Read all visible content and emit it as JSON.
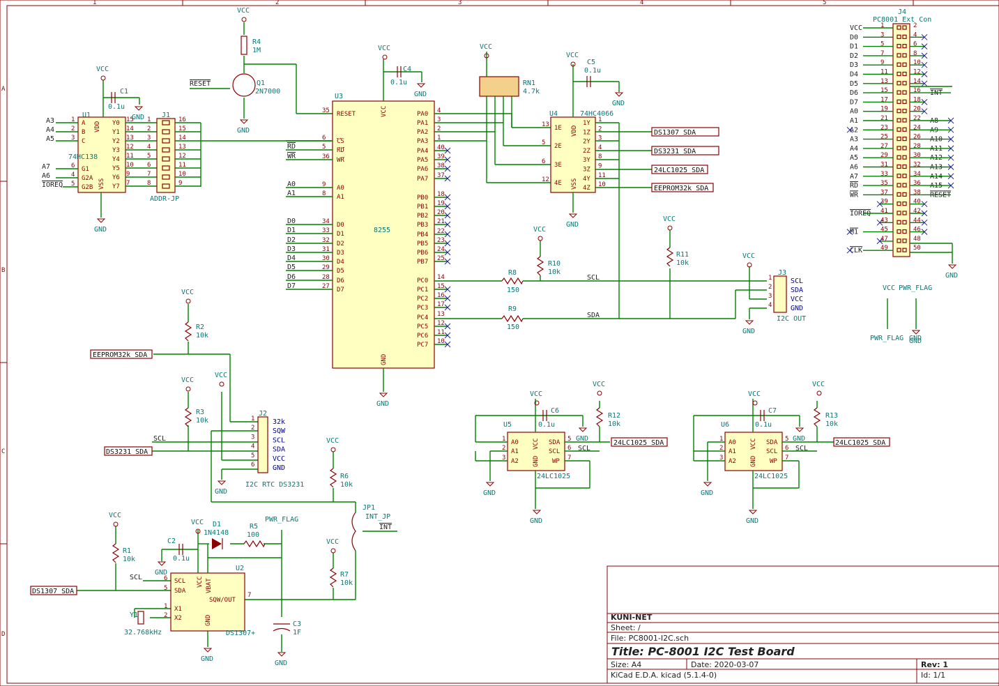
{
  "frame": {
    "col_numbers": [
      "1",
      "2",
      "3",
      "4",
      "5"
    ],
    "row_letters": [
      "A",
      "B",
      "C",
      "D"
    ]
  },
  "title_block": {
    "company": "KUNI-NET",
    "sheet": "Sheet: /",
    "file": "File: PC8001-I2C.sch",
    "title": "Title: PC-8001 I2C Test Board",
    "size": "Size: A4",
    "date": "Date: 2020-03-07",
    "rev": "Rev: 1",
    "tool": "KiCad E.D.A.  kicad (5.1.4-0)",
    "id": "Id: 1/1"
  },
  "power": {
    "vcc": "VCC",
    "gnd": "GND",
    "pwr_flag": "PWR_FLAG"
  },
  "u1": {
    "ref": "U1",
    "value": "74HC138",
    "pins_left": [
      "A",
      "B",
      "C",
      "G1",
      "G2A",
      "G2B"
    ],
    "pins_right": [
      "Y0",
      "Y1",
      "Y2",
      "Y3",
      "Y4",
      "Y5",
      "Y6",
      "Y7"
    ],
    "vdd": "VDD",
    "vss": "VSS",
    "inputs": [
      "A3",
      "A4",
      "A5",
      "A7",
      "A6",
      "IOREQ"
    ]
  },
  "c1": {
    "ref": "C1",
    "value": "0.1u"
  },
  "j1": {
    "ref": "J1",
    "value": "ADDR-JP"
  },
  "r4": {
    "ref": "R4",
    "value": "1M"
  },
  "q1": {
    "ref": "Q1",
    "value": "2N7000",
    "net": "RESET"
  },
  "u3": {
    "ref": "U3",
    "value": "8255",
    "vcc": "VCC",
    "gnd": "GND",
    "left_pins": [
      {
        "name": "RESET",
        "num": "35"
      },
      {
        "name": "CS",
        "num": "6"
      },
      {
        "name": "RD",
        "num": "5"
      },
      {
        "name": "WR",
        "num": "36"
      },
      {
        "name": "A0",
        "num": "9"
      },
      {
        "name": "A1",
        "num": "8"
      },
      {
        "name": "D0",
        "num": "34"
      },
      {
        "name": "D1",
        "num": "33"
      },
      {
        "name": "D2",
        "num": "32"
      },
      {
        "name": "D3",
        "num": "31"
      },
      {
        "name": "D4",
        "num": "30"
      },
      {
        "name": "D5",
        "num": "29"
      },
      {
        "name": "D6",
        "num": "28"
      },
      {
        "name": "D7",
        "num": "27"
      }
    ],
    "right_pins": [
      {
        "name": "PA0",
        "num": "4"
      },
      {
        "name": "PA1",
        "num": "3"
      },
      {
        "name": "PA2",
        "num": "2"
      },
      {
        "name": "PA3",
        "num": "1"
      },
      {
        "name": "PA4",
        "num": "40"
      },
      {
        "name": "PA5",
        "num": "39"
      },
      {
        "name": "PA6",
        "num": "38"
      },
      {
        "name": "PA7",
        "num": "37"
      },
      {
        "name": "PB0",
        "num": "18"
      },
      {
        "name": "PB1",
        "num": "19"
      },
      {
        "name": "PB2",
        "num": "20"
      },
      {
        "name": "PB3",
        "num": "21"
      },
      {
        "name": "PB4",
        "num": "22"
      },
      {
        "name": "PB5",
        "num": "23"
      },
      {
        "name": "PB6",
        "num": "24"
      },
      {
        "name": "PB7",
        "num": "25"
      },
      {
        "name": "PC0",
        "num": "14"
      },
      {
        "name": "PC1",
        "num": "15"
      },
      {
        "name": "PC2",
        "num": "16"
      },
      {
        "name": "PC3",
        "num": "17"
      },
      {
        "name": "PC4",
        "num": "13"
      },
      {
        "name": "PC5",
        "num": "12"
      },
      {
        "name": "PC6",
        "num": "11"
      },
      {
        "name": "PC7",
        "num": "10"
      }
    ],
    "left_nets": [
      "RESET",
      "RD",
      "WR",
      "A0",
      "A1",
      "D0",
      "D1",
      "D2",
      "D3",
      "D4",
      "D5",
      "D6",
      "D7"
    ]
  },
  "c4": {
    "ref": "C4",
    "value": "0.1u"
  },
  "rn1": {
    "ref": "RN1",
    "value": "4.7k"
  },
  "u4": {
    "ref": "U4",
    "value": "74HC4066",
    "pins": [
      "1E",
      "2E",
      "3E",
      "4E",
      "1Y",
      "1Z",
      "2Y",
      "2Z",
      "3Y",
      "3Z",
      "4Y",
      "4Z"
    ],
    "vdd": "VDD",
    "vss": "VSS"
  },
  "c5": {
    "ref": "C5",
    "value": "0.1u"
  },
  "hier_labels": [
    "DS1307_SDA",
    "DS3231_SDA",
    "24LC1025_SDA",
    "EEPROM32k_SDA"
  ],
  "r8": {
    "ref": "R8",
    "value": "150"
  },
  "r9": {
    "ref": "R9",
    "value": "150"
  },
  "r10": {
    "ref": "R10",
    "value": "10k"
  },
  "r11": {
    "ref": "R11",
    "value": "10k"
  },
  "nets": {
    "scl": "SCL",
    "sda": "SDA",
    "int": "INT"
  },
  "j3": {
    "ref": "J3",
    "value": "I2C OUT",
    "pins": [
      "SCL",
      "SDA",
      "VCC",
      "GND"
    ]
  },
  "j4": {
    "ref": "J4",
    "value": "PC8001 Ext Con",
    "left": [
      "VCC",
      "D0",
      "D1",
      "D2",
      "D3",
      "D4",
      "D5",
      "D6",
      "D7",
      "A0",
      "A1",
      "A2",
      "A3",
      "A4",
      "A5",
      "A6",
      "A7",
      "RD",
      "WR",
      "",
      "IOREQ",
      "",
      "M1",
      "",
      "CLK"
    ],
    "right_labels": {
      "7": "INT",
      "10": "A8",
      "11": "A9",
      "12": "A10",
      "13": "A11",
      "14": "A12",
      "15": "A13",
      "16": "A14",
      "17": "A15",
      "18": "RESET"
    }
  },
  "r2": {
    "ref": "R2",
    "value": "10k"
  },
  "r3": {
    "ref": "R3",
    "value": "10k"
  },
  "j2": {
    "ref": "J2",
    "value": "I2C RTC DS3231",
    "pins": [
      "32k",
      "SQW",
      "SCL",
      "SDA",
      "VCC",
      "GND"
    ]
  },
  "r6": {
    "ref": "R6",
    "value": "10k"
  },
  "r7": {
    "ref": "R7",
    "value": "10k"
  },
  "jp1": {
    "ref": "JP1",
    "value": "INT_JP"
  },
  "r1": {
    "ref": "R1",
    "value": "10k"
  },
  "c2": {
    "ref": "C2",
    "value": "0.1u"
  },
  "d1": {
    "ref": "D1",
    "value": "1N4148"
  },
  "r5": {
    "ref": "R5",
    "value": "100"
  },
  "u2": {
    "ref": "U2",
    "value": "DS1307+",
    "pins": [
      "SCL",
      "SDA",
      "X1",
      "X2",
      "VCC",
      "VBAT",
      "SQW/OUT",
      "GND"
    ]
  },
  "y1": {
    "ref": "Y1",
    "value": "32.768kHz"
  },
  "c3": {
    "ref": "C3",
    "value": "1F"
  },
  "u5": {
    "ref": "U5",
    "value": "24LC1025",
    "pins": [
      "A0",
      "A1",
      "A2",
      "VCC",
      "GND",
      "SDA",
      "SCL",
      "WP"
    ]
  },
  "c6": {
    "ref": "C6",
    "value": "0.1u"
  },
  "r12": {
    "ref": "R12",
    "value": "10k"
  },
  "u6": {
    "ref": "U6",
    "value": "24LC1025",
    "pins": [
      "A0",
      "A1",
      "A2",
      "VCC",
      "GND",
      "SDA",
      "SCL",
      "WP"
    ]
  },
  "c7": {
    "ref": "C7",
    "value": "0.1u"
  },
  "r13": {
    "ref": "R13",
    "value": "10k"
  }
}
